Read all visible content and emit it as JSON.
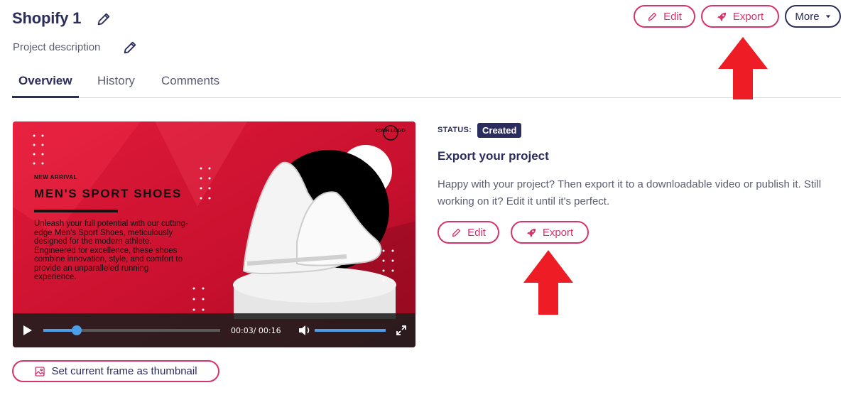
{
  "header": {
    "title": "Shopify 1",
    "description": "Project description",
    "edit_label": "Edit",
    "export_label": "Export",
    "more_label": "More"
  },
  "tabs": [
    {
      "label": "Overview",
      "active": true
    },
    {
      "label": "History",
      "active": false
    },
    {
      "label": "Comments",
      "active": false
    }
  ],
  "video": {
    "ad": {
      "logo": "YOUR LOGO",
      "eyebrow": "NEW ARRIVAL",
      "headline": "MEN'S SPORT SHOES",
      "body": "Unleash your full potential with our cutting-edge Men's Sport Shoes, meticulously designed for the modern athlete. Engineered for excellence, these shoes combine innovation, style, and comfort to provide an unparalleled running experience."
    },
    "time_display": "00:03/ 00:16",
    "progress_fraction": 0.1875,
    "volume_fraction": 1.0
  },
  "export_panel": {
    "status_label": "STATUS:",
    "status_value": "Created",
    "heading": "Export your project",
    "text": "Happy with your project? Then export it to a downloadable video or publish it. Still working on it? Edit it until it's perfect.",
    "edit_label": "Edit",
    "export_label": "Export"
  },
  "thumbnail_button": "Set current frame as thumbnail",
  "colors": {
    "accent": "#d6336c",
    "navy": "#2b2d5c",
    "annotation_arrow": "#ee1c25",
    "video_red": "#c8102e"
  },
  "icons": [
    "pencil-icon",
    "rocket-icon",
    "caret-down-icon",
    "play-icon",
    "volume-icon",
    "fullscreen-icon",
    "image-icon",
    "up-arrow"
  ]
}
